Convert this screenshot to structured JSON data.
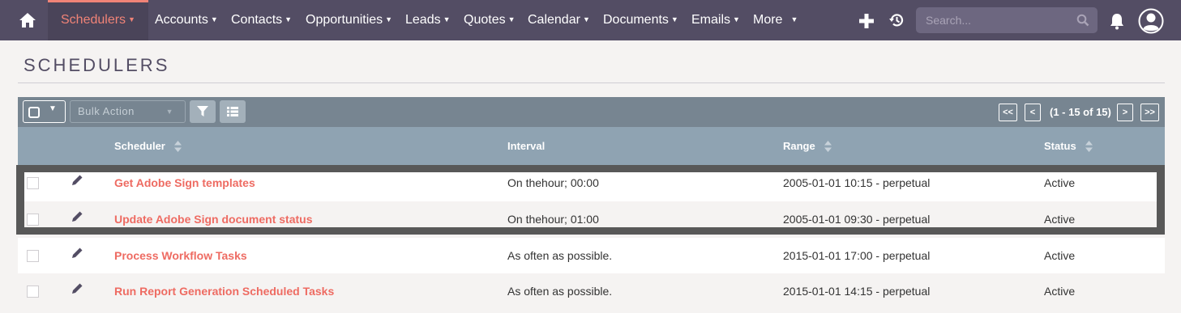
{
  "nav": {
    "items": [
      {
        "label": "Schedulers",
        "active": true
      },
      {
        "label": "Accounts"
      },
      {
        "label": "Contacts"
      },
      {
        "label": "Opportunities"
      },
      {
        "label": "Leads"
      },
      {
        "label": "Quotes"
      },
      {
        "label": "Calendar"
      },
      {
        "label": "Documents"
      },
      {
        "label": "Emails"
      },
      {
        "label": "More"
      }
    ],
    "search_placeholder": "Search...",
    "icons": [
      "home-icon",
      "plus-icon",
      "history-icon",
      "search-icon",
      "bell-icon",
      "user-icon"
    ],
    "accent_color": "#f08377",
    "bg_color": "#534d64"
  },
  "page": {
    "title": "SCHEDULERS"
  },
  "toolbar": {
    "bulk_action_label": "Bulk Action",
    "pagination": {
      "first": "<<",
      "prev": "<",
      "info": "(1 - 15 of 15)",
      "next": ">",
      "last": ">>"
    }
  },
  "table": {
    "columns": [
      "Scheduler",
      "Interval",
      "Range",
      "Status"
    ],
    "rows": [
      {
        "name": "Get Adobe Sign templates",
        "interval": "On thehour; 00:00",
        "range": "2005-01-01 10:15 - perpetual",
        "status": "Active",
        "highlighted": true
      },
      {
        "name": "Update Adobe Sign document status",
        "interval": "On thehour; 01:00",
        "range": "2005-01-01 09:30 - perpetual",
        "status": "Active",
        "highlighted": true
      },
      {
        "name": "Process Workflow Tasks",
        "interval": "As often as possible.",
        "range": "2015-01-01 17:00 - perpetual",
        "status": "Active"
      },
      {
        "name": "Run Report Generation Scheduled Tasks",
        "interval": "As often as possible.",
        "range": "2015-01-01 14:15 - perpetual",
        "status": "Active"
      }
    ],
    "link_color": "#ee6b62"
  }
}
